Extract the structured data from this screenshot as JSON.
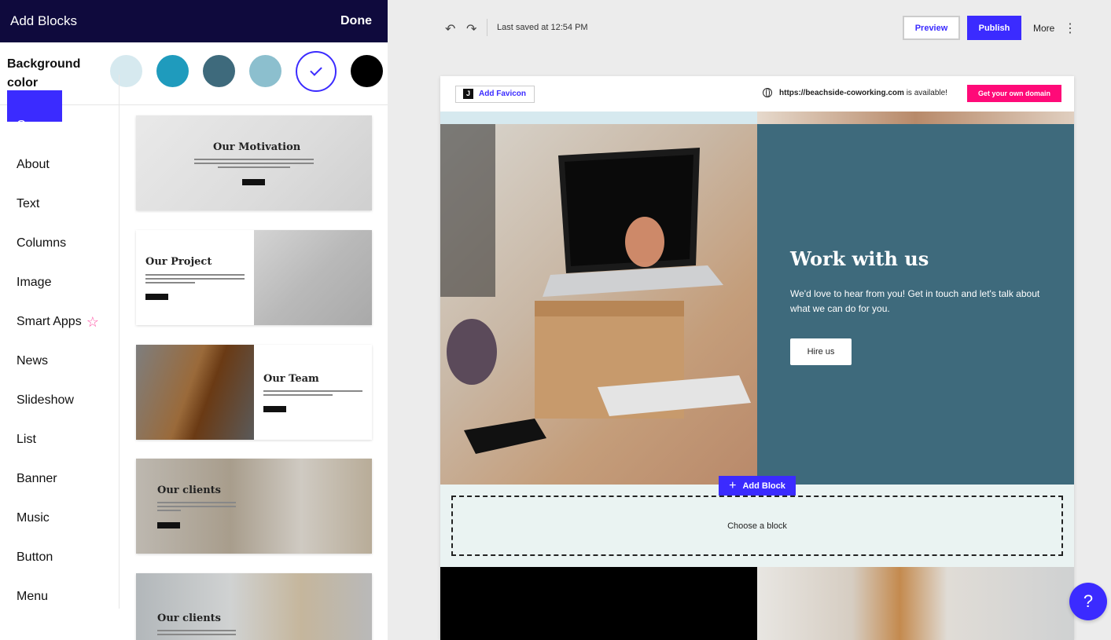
{
  "panel": {
    "title": "Add Blocks",
    "done_label": "Done",
    "background_label": "Background color",
    "swatches": [
      "#d6e9ef",
      "#1f9bbd",
      "#3e6a7c",
      "#8cbfce",
      "#ffffff",
      "#000000"
    ],
    "selected_swatch_index": 4,
    "categories": [
      "Cover",
      "About",
      "Text",
      "Columns",
      "Image",
      "Smart Apps",
      "News",
      "Slideshow",
      "List",
      "Banner",
      "Music",
      "Button",
      "Menu"
    ],
    "active_category": "Cover",
    "thumbnails": [
      {
        "title": "Our Motivation",
        "layout": "full-image-center"
      },
      {
        "title": "Our Project",
        "layout": "text-left-image-right"
      },
      {
        "title": "Our Team",
        "layout": "image-left-text-right"
      },
      {
        "title": "Our clients",
        "layout": "full-image-left-text"
      },
      {
        "title": "Our clients",
        "layout": "full-image-left-text"
      }
    ]
  },
  "toolbar": {
    "saved_text": "Last saved at 12:54 PM",
    "preview_label": "Preview",
    "publish_label": "Publish",
    "more_label": "More"
  },
  "canvas": {
    "favicon_label": "Add Favicon",
    "favicon_letter": "J",
    "domain_url": "https://beachside-coworking.com",
    "domain_suffix": " is available!",
    "get_domain_label": "Get your own domain",
    "hero_title": "Work with us",
    "hero_body": "We'd love to hear from you! Get in touch and let's talk about what we can do for you.",
    "hire_label": "Hire us",
    "add_block_label": "Add Block",
    "choose_label": "Choose a block"
  },
  "help": {
    "label": "?"
  },
  "colors": {
    "accent": "#3b2bff",
    "header": "#0f0a3d",
    "hero_bg": "#3e6a7c",
    "domain_cta": "#ff0a78"
  }
}
